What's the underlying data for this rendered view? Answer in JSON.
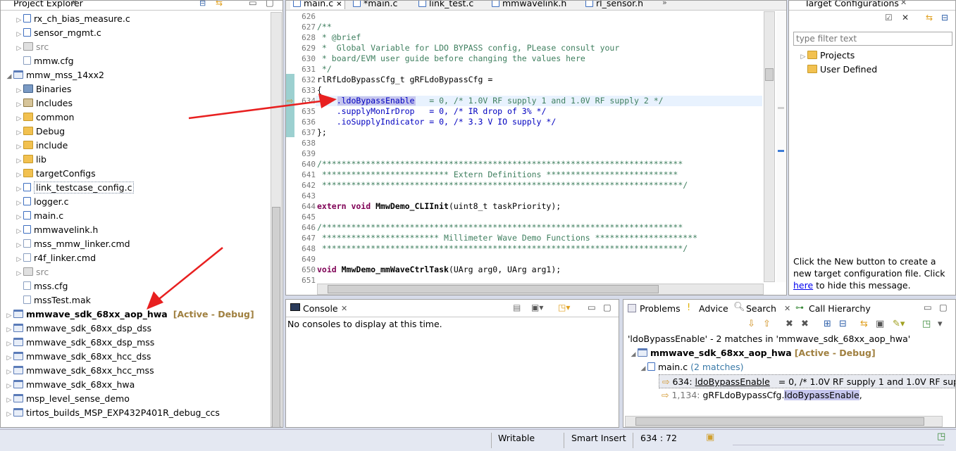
{
  "project_explorer": {
    "title": "Project Explorer",
    "items": [
      {
        "label": "rx_ch_bias_measure.c",
        "type": "cfile"
      },
      {
        "label": "sensor_mgmt.c",
        "type": "cfile"
      },
      {
        "label": "src",
        "type": "gray"
      },
      {
        "label": "mmw.cfg",
        "type": "file"
      },
      {
        "label": "mmw_mss_14xx2",
        "type": "proj"
      },
      {
        "label": "Binaries",
        "type": "bin"
      },
      {
        "label": "Includes",
        "type": "inc"
      },
      {
        "label": "common",
        "type": "fold"
      },
      {
        "label": "Debug",
        "type": "fold"
      },
      {
        "label": "include",
        "type": "fold"
      },
      {
        "label": "lib",
        "type": "fold"
      },
      {
        "label": "targetConfigs",
        "type": "fold"
      },
      {
        "label": "link_testcase_config.c",
        "type": "cfile"
      },
      {
        "label": "logger.c",
        "type": "cfile"
      },
      {
        "label": "main.c",
        "type": "cfile"
      },
      {
        "label": "mmwavelink.h",
        "type": "cfile"
      },
      {
        "label": "mss_mmw_linker.cmd",
        "type": "file"
      },
      {
        "label": "r4f_linker.cmd",
        "type": "file"
      },
      {
        "label": "src",
        "type": "gray"
      },
      {
        "label": "mss.cfg",
        "type": "file"
      },
      {
        "label": "mssTest.mak",
        "type": "file"
      },
      {
        "label": "mmwave_sdk_68xx_aop_hwa",
        "type": "proj"
      },
      {
        "label": "mmwave_sdk_68xx_dsp_dss",
        "type": "proj"
      },
      {
        "label": "mmwave_sdk_68xx_dsp_mss",
        "type": "proj"
      },
      {
        "label": "mmwave_sdk_68xx_hcc_dss",
        "type": "proj"
      },
      {
        "label": "mmwave_sdk_68xx_hcc_mss",
        "type": "proj"
      },
      {
        "label": "mmwave_sdk_68xx_hwa",
        "type": "proj"
      },
      {
        "label": "msp_level_sense_demo",
        "type": "proj"
      },
      {
        "label": "tirtos_builds_MSP_EXP432P401R_debug_ccs",
        "type": "proj"
      }
    ],
    "active_suffix": "[Active - Debug]"
  },
  "editor": {
    "tabs": [
      "main.c",
      "*main.c",
      "link_test.c",
      "mmwavelink.h",
      "rl_sensor.h"
    ],
    "line_numbers": [
      "626",
      "627",
      "628",
      "629",
      "630",
      "631",
      "632",
      "633",
      "634",
      "635",
      "636",
      "637",
      "638",
      "639",
      "640",
      "641",
      "642",
      "643",
      "644",
      "645",
      "646",
      "647",
      "648",
      "649",
      "650",
      "651"
    ],
    "lines": {
      "l627": "/**",
      "l628": " * @brief",
      "l629": " *  Global Variable for LDO BYPASS config, PLease consult your",
      "l630": " * board/EVM user guide before changing the values here",
      "l631": " */",
      "l632": "rlRfLdoBypassCfg_t gRFLdoBypassCfg =",
      "l633": "{",
      "l634_field": ".ldoBypassEnable",
      "l634_rest": "   = 0, /* 1.0V RF supply 1 and 1.0V RF supply 2 */",
      "l635": "    .supplyMonIrDrop   = 0, /* IR drop of 3% */",
      "l636": "    .ioSupplyIndicator = 0, /* 3.3 V IO supply */",
      "l637": "};",
      "l640": "/**************************************************************************",
      "l641": " ************************** Extern Definitions ***************************",
      "l642": " **************************************************************************/",
      "l644_kw": "extern void ",
      "l644_fn": "MmwDemo_CLIInit",
      "l644_rest": "(uint8_t taskPriority);",
      "l646": "/**************************************************************************",
      "l647": " ************************ Millimeter Wave Demo Functions *********************",
      "l648": " **************************************************************************/",
      "l650_kw": "void ",
      "l650_fn": "MmwDemo_mmWaveCtrlTask",
      "l650_rest": "(UArg arg0, UArg arg1);"
    }
  },
  "target_config": {
    "title": "Target Configurations",
    "filter_placeholder": "type filter text",
    "items": [
      "Projects",
      "User Defined"
    ],
    "help_pre": "Click the New button to create a new target configuration file. Click ",
    "help_link": "here",
    "help_post": " to hide this message."
  },
  "console": {
    "title": "Console",
    "message": "No consoles to display at this time."
  },
  "search_view": {
    "tabs": [
      "Problems",
      "Advice",
      "Search",
      "Call Hierarchy"
    ],
    "summary": "'ldoBypassEnable' - 2 matches in 'mmwave_sdk_68xx_aop_hwa'",
    "project": "mmwave_sdk_68xx_aop_hwa",
    "project_suffix": "[Active - Debug]",
    "file": "main.c",
    "file_count": "(2 matches)",
    "match1_line": "634:",
    "match1_hl": "ldoBypassEnable",
    "match1_rest": "   = 0, /* 1.0V RF supply 1 and 1.0V RF supply",
    "match2_line": "1,134:",
    "match2_pre": "gRFLdoBypassCfg.",
    "match2_hl": "ldoBypassEnable",
    "match2_rest": ","
  },
  "status_bar": {
    "writable": "Writable",
    "insert_mode": "Smart Insert",
    "position": "634 : 72"
  },
  "colors": {
    "arrow": "#e82020",
    "highlight": "#c6c6ee",
    "current_line": "#e8f2fe"
  }
}
